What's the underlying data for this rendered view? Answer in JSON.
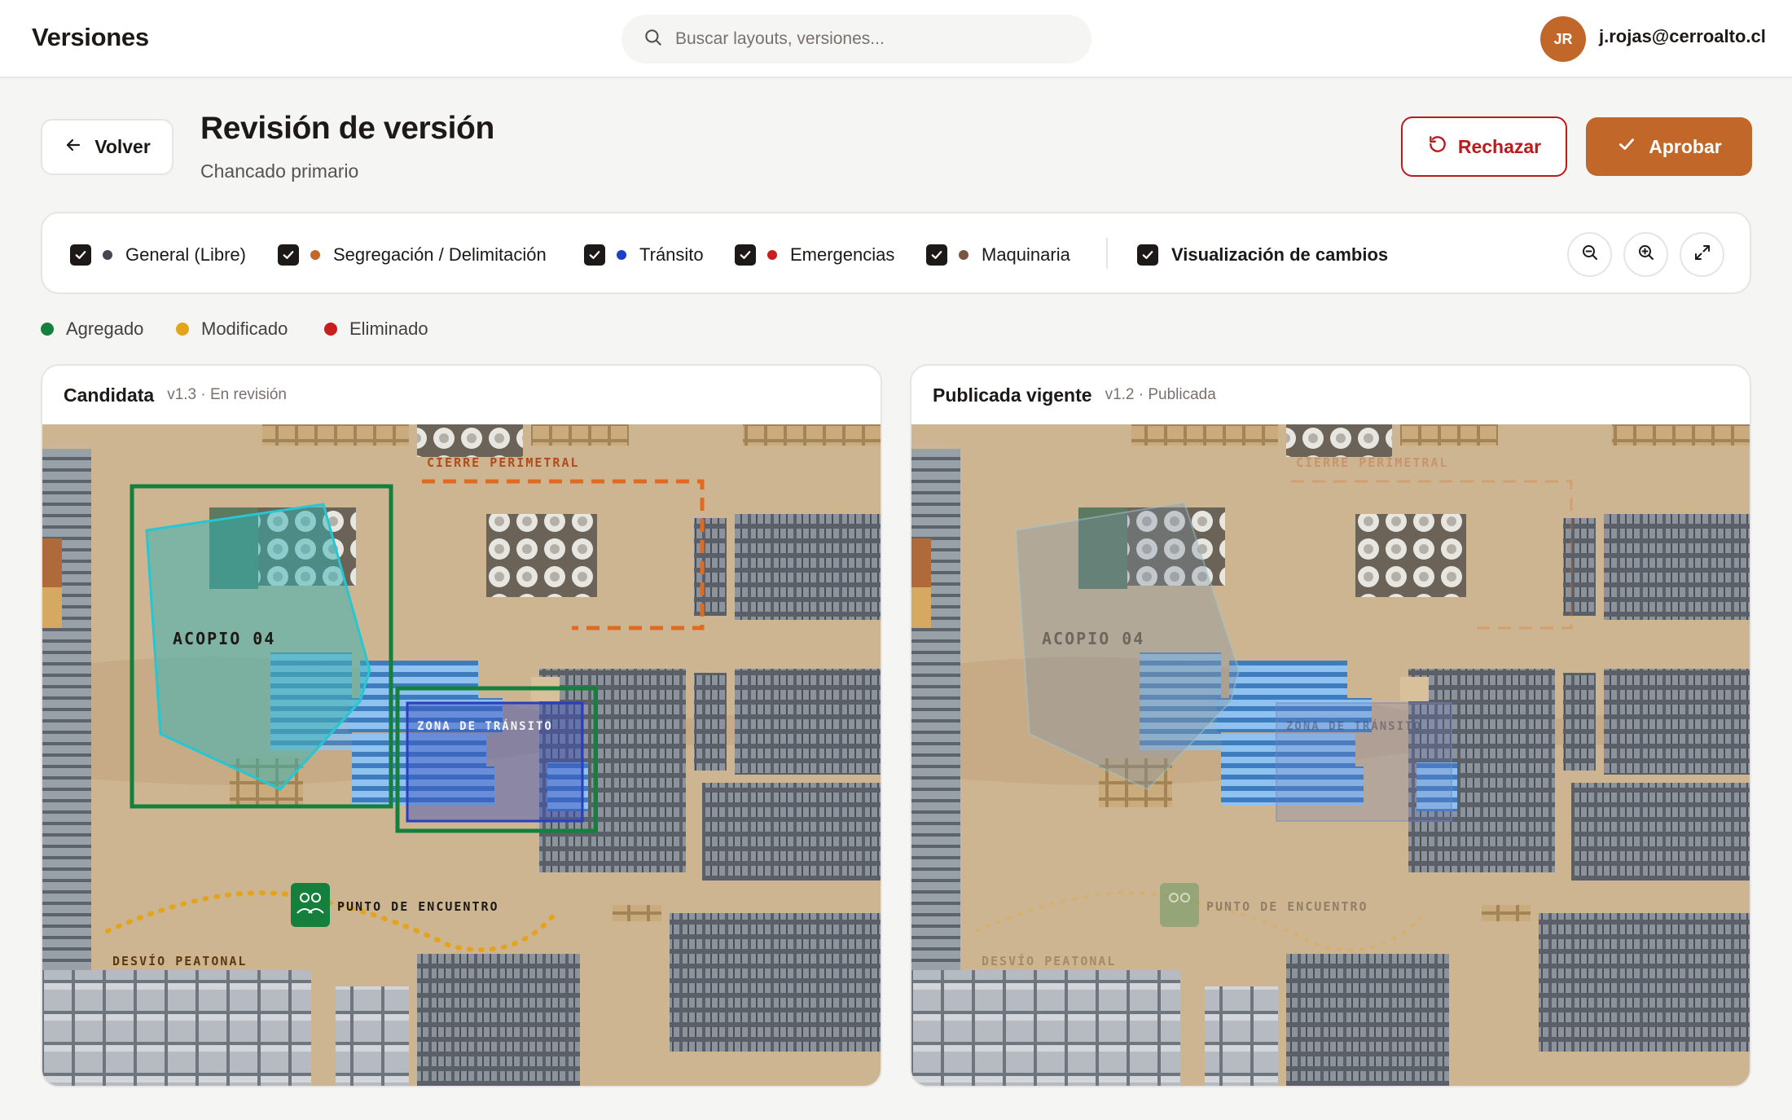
{
  "app": {
    "title": "Versiones"
  },
  "search": {
    "placeholder": "Buscar layouts, versiones..."
  },
  "user": {
    "initials": "JR",
    "email": "j.rojas@cerroalto.cl",
    "avatar_color": "#c2672a"
  },
  "header": {
    "back_label": "Volver",
    "title": "Revisión de versión",
    "subtitle": "Chancado primario",
    "reject_label": "Rechazar",
    "approve_label": "Aprobar"
  },
  "colors": {
    "accent": "#c2672a",
    "danger": "#b91c1c",
    "added": "#15803d",
    "modified": "#e3a31a",
    "removed": "#c81e1e"
  },
  "filters": [
    {
      "label": "General (Libre)",
      "color": "#44474f",
      "checked": true
    },
    {
      "label": "Segregación / Delimitación",
      "color": "#c2672a",
      "checked": true
    },
    {
      "label": "Tránsito",
      "color": "#1d3fc8",
      "checked": true
    },
    {
      "label": "Emergencias",
      "color": "#c81e1e",
      "checked": true
    },
    {
      "label": "Maquinaria",
      "color": "#7a5640",
      "checked": true
    }
  ],
  "change_view": {
    "label": "Visualización de cambios",
    "checked": true
  },
  "tools": [
    "zoom-out-icon",
    "zoom-in-icon",
    "expand-icon"
  ],
  "legend": [
    {
      "label": "Agregado",
      "color": "#15803d"
    },
    {
      "label": "Modificado",
      "color": "#e3a31a"
    },
    {
      "label": "Eliminado",
      "color": "#c81e1e"
    }
  ],
  "panels": {
    "candidate": {
      "title": "Candidata",
      "meta": "v1.3 · En revisión"
    },
    "published": {
      "title": "Publicada vigente",
      "meta": "v1.2 · Publicada"
    }
  },
  "map_labels": {
    "perimeter": "CIERRE PERIMETRAL",
    "stockpile": "ACOPIO 04",
    "transit": "ZONA DE TRÁNSITO",
    "meeting": "PUNTO DE ENCUENTRO",
    "detour": "DESVÍO PEATONAL"
  }
}
